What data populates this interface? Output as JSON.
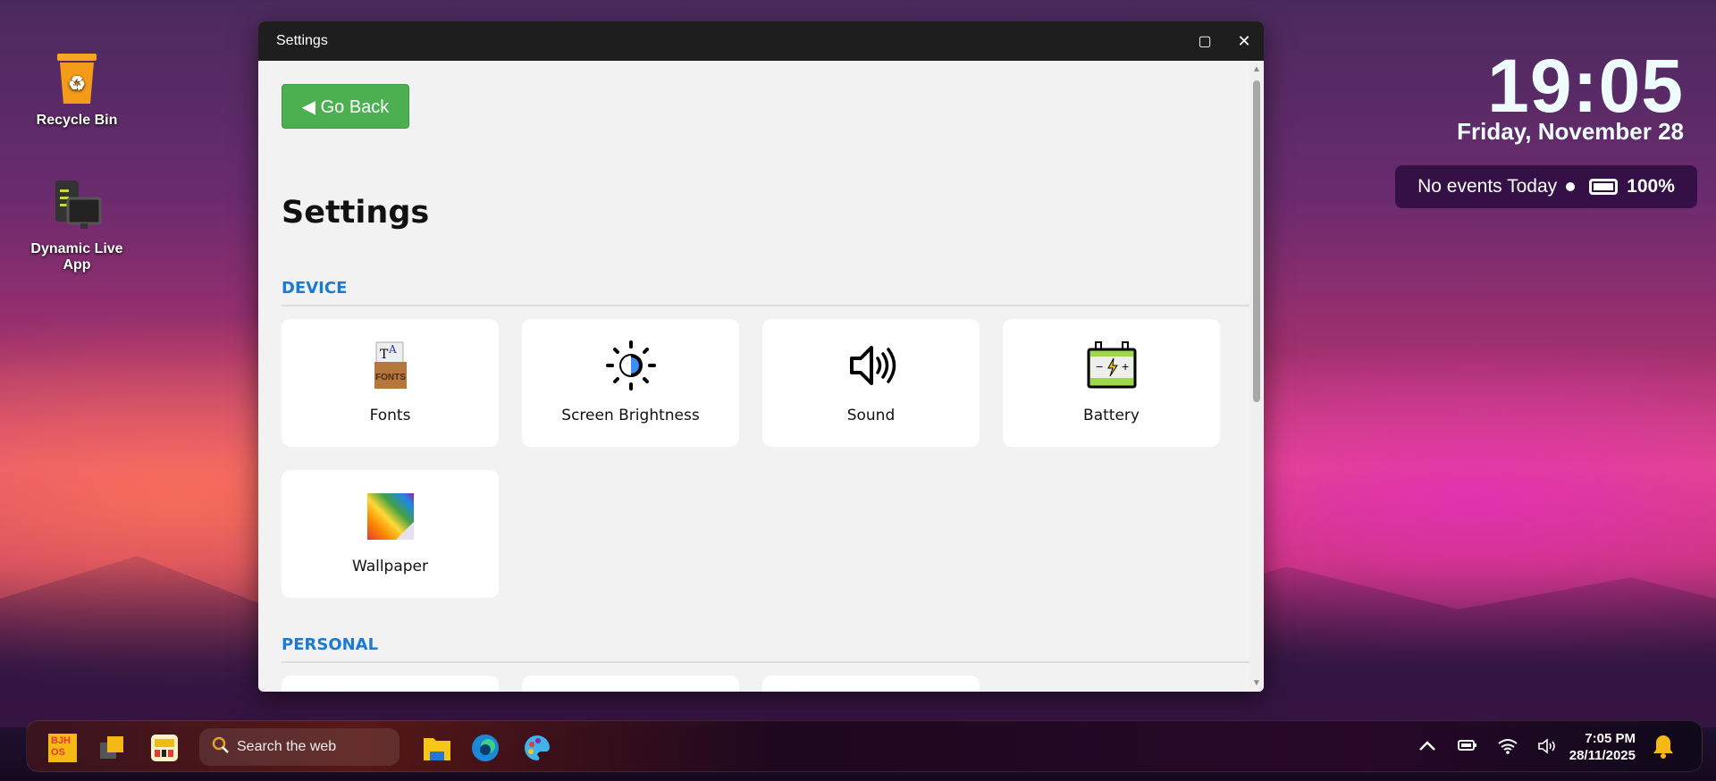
{
  "desktop": {
    "icons": [
      {
        "label": "Recycle Bin",
        "icon": "recycle-bin-icon"
      },
      {
        "label": "Dynamic Live App",
        "icon": "dynamic-live-app-icon"
      }
    ]
  },
  "widget": {
    "time": "19:05",
    "date": "Friday, November 28",
    "events": "No events Today",
    "battery": "100%"
  },
  "window": {
    "title": "Settings",
    "maximize": "▢",
    "close": "✕",
    "go_back": "◀ Go Back",
    "heading": "Settings",
    "sections": [
      {
        "title": "DEVICE",
        "items": [
          {
            "label": "Fonts"
          },
          {
            "label": "Screen Brightness"
          },
          {
            "label": "Sound"
          },
          {
            "label": "Battery"
          },
          {
            "label": "Wallpaper"
          }
        ]
      },
      {
        "title": "PERSONAL",
        "items": [
          {
            "label": ""
          },
          {
            "label": ""
          },
          {
            "label": ""
          }
        ]
      }
    ]
  },
  "taskbar": {
    "start": "BJH OS",
    "search_placeholder": "Search the web",
    "time": "7:05 PM",
    "date": "28/11/2025"
  },
  "colors": {
    "accent": "#1a7ad4",
    "go_back": "#4caf50",
    "bell": "#f5b915"
  }
}
